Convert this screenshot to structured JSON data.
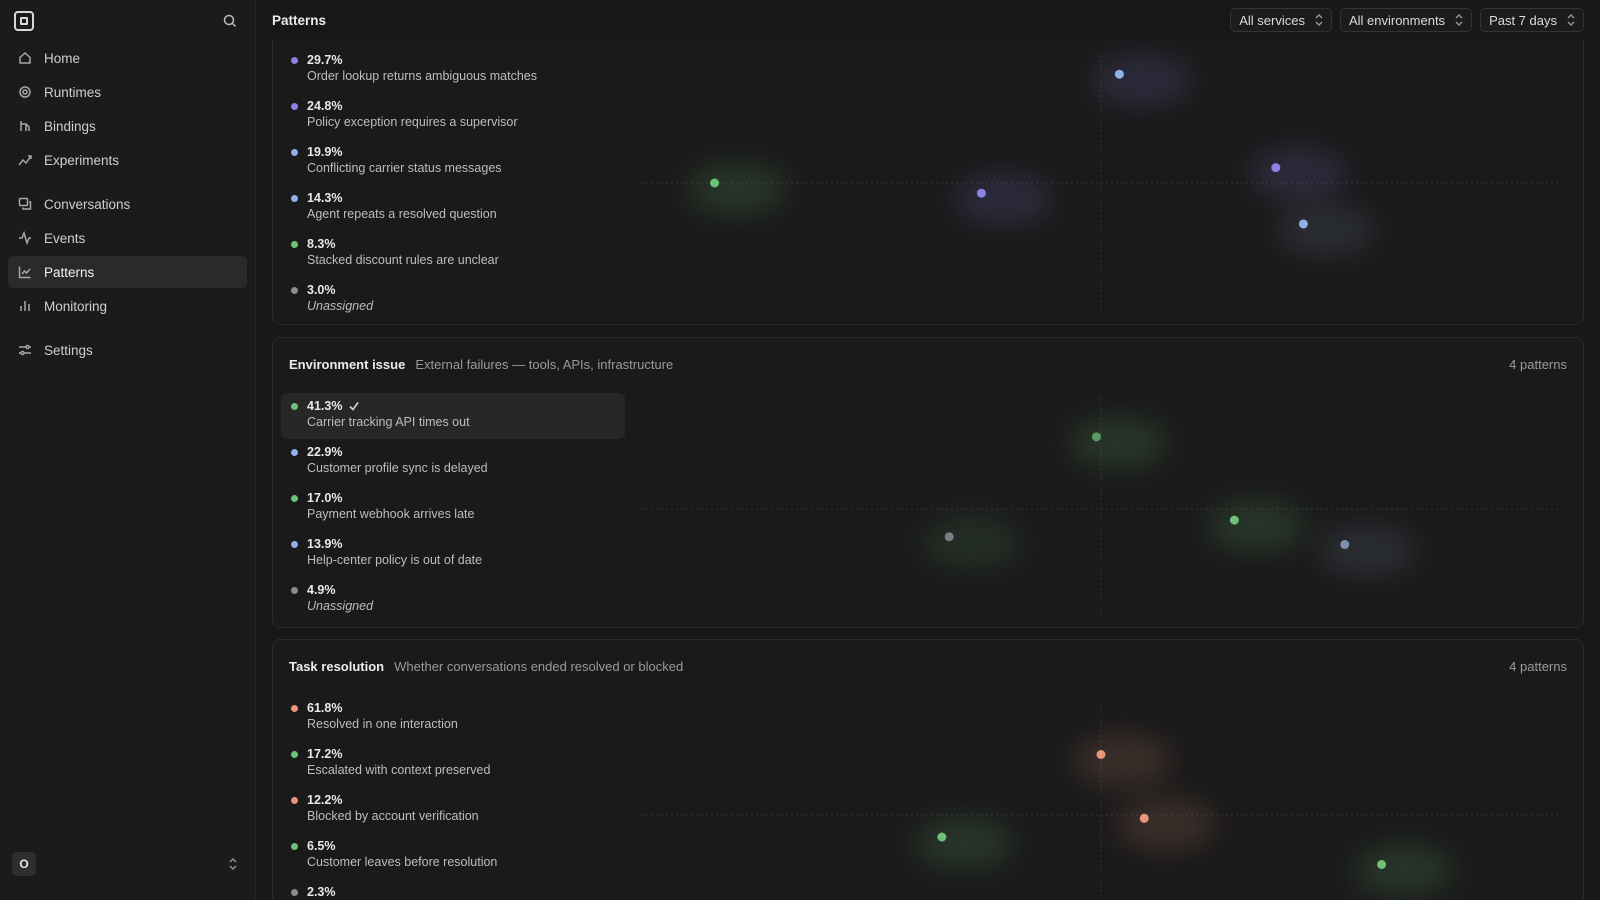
{
  "sidebar": {
    "items": [
      {
        "label": "Home",
        "icon": "home-icon"
      },
      {
        "label": "Runtimes",
        "icon": "runtime-icon"
      },
      {
        "label": "Bindings",
        "icon": "binding-icon"
      },
      {
        "label": "Experiments",
        "icon": "experiment-icon"
      },
      {
        "label": "Conversations",
        "icon": "conversation-icon"
      },
      {
        "label": "Events",
        "icon": "activity-icon"
      },
      {
        "label": "Patterns",
        "icon": "scatter-chart-icon",
        "active": true
      },
      {
        "label": "Monitoring",
        "icon": "bar-chart-icon"
      },
      {
        "label": "Settings",
        "icon": "sliders-icon"
      }
    ],
    "avatar_initial": "O"
  },
  "header": {
    "title": "Patterns",
    "filters": {
      "service": "All services",
      "environment": "All environments",
      "range": "Past 7 days"
    }
  },
  "colors": {
    "purple": "#8b82e8",
    "blue": "#8fb0e8",
    "green": "#6ec277",
    "grey": "#8c8c8c",
    "orange": "#e8967a",
    "slate": "#7e8fb0",
    "dim_green": "#5b9a63",
    "dim_grey": "#7a7f86"
  },
  "groups": [
    {
      "title": "",
      "subtitle": "",
      "count": "",
      "rows": [
        {
          "pct": "29.7%",
          "label": "Order lookup returns ambiguous matches",
          "color": "purple"
        },
        {
          "pct": "24.8%",
          "label": "Policy exception requires a supervisor",
          "color": "purple"
        },
        {
          "pct": "19.9%",
          "label": "Conflicting carrier status messages",
          "color": "blue"
        },
        {
          "pct": "14.3%",
          "label": "Agent repeats a resolved question",
          "color": "blue"
        },
        {
          "pct": "8.3%",
          "label": "Stacked discount rules are unclear",
          "color": "green"
        },
        {
          "pct": "3.0%",
          "label": "Unassigned",
          "color": "grey",
          "italic": true
        }
      ],
      "points": [
        {
          "x": 0.52,
          "y": 0.85,
          "color": "blue",
          "glow": "purple"
        },
        {
          "x": 0.69,
          "y": 0.12,
          "color": "purple",
          "glow": "purple"
        },
        {
          "x": 0.37,
          "y": -0.08,
          "color": "purple",
          "glow": "purple"
        },
        {
          "x": 0.72,
          "y": -0.32,
          "color": "blue",
          "glow": "slate"
        },
        {
          "x": 0.08,
          "y": 0.0,
          "color": "green",
          "glow": "green"
        }
      ]
    },
    {
      "title": "Environment issue",
      "subtitle": "External failures — tools, APIs, infrastructure",
      "count": "4 patterns",
      "rows": [
        {
          "pct": "41.3%",
          "label": "Carrier tracking API times out",
          "color": "green",
          "selected": true
        },
        {
          "pct": "22.9%",
          "label": "Customer profile sync is delayed",
          "color": "blue"
        },
        {
          "pct": "17.0%",
          "label": "Payment webhook arrives late",
          "color": "green"
        },
        {
          "pct": "13.9%",
          "label": "Help-center policy is out of date",
          "color": "blue"
        },
        {
          "pct": "4.9%",
          "label": "Unassigned",
          "color": "grey",
          "italic": true
        }
      ],
      "points": [
        {
          "x": 0.495,
          "y": 0.65,
          "color": "dim_green",
          "glow": "green"
        },
        {
          "x": 0.645,
          "y": -0.1,
          "color": "green",
          "glow": "green"
        },
        {
          "x": 0.335,
          "y": -0.25,
          "color": "dim_grey",
          "glow": "dim_green"
        },
        {
          "x": 0.765,
          "y": -0.32,
          "color": "slate",
          "glow": "slate"
        }
      ]
    },
    {
      "title": "Task resolution",
      "subtitle": "Whether conversations ended resolved or blocked",
      "count": "4 patterns",
      "rows": [
        {
          "pct": "61.8%",
          "label": "Resolved in one interaction",
          "color": "orange"
        },
        {
          "pct": "17.2%",
          "label": "Escalated with context preserved",
          "color": "green"
        },
        {
          "pct": "12.2%",
          "label": "Blocked by account verification",
          "color": "orange"
        },
        {
          "pct": "6.5%",
          "label": "Customer leaves before resolution",
          "color": "green"
        },
        {
          "pct": "2.3%",
          "label": "",
          "color": "grey"
        }
      ],
      "points": [
        {
          "x": 0.5,
          "y": 0.55,
          "color": "orange",
          "glow": "orange"
        },
        {
          "x": 0.547,
          "y": -0.03,
          "color": "orange",
          "glow": "orange"
        },
        {
          "x": 0.327,
          "y": -0.2,
          "color": "green",
          "glow": "green"
        },
        {
          "x": 0.805,
          "y": -0.45,
          "color": "green",
          "glow": "green"
        }
      ]
    }
  ]
}
